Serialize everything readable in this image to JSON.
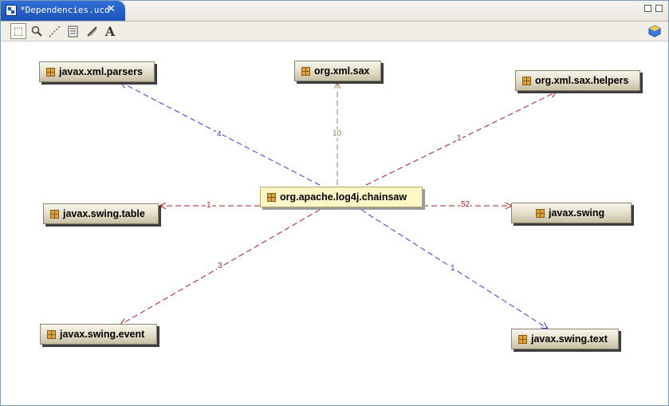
{
  "tab": {
    "title": "*Dependencies.ucd",
    "close": "✕"
  },
  "toolbar": {
    "tools": [
      {
        "name": "select-tool",
        "glyph": "⬚"
      },
      {
        "name": "zoom-tool",
        "glyph": "🔍"
      },
      {
        "name": "connector-tool",
        "glyph": "⋰"
      },
      {
        "name": "note-tool",
        "glyph": "▤"
      },
      {
        "name": "link-tool",
        "glyph": "✎"
      },
      {
        "name": "text-tool",
        "glyph": "A"
      }
    ],
    "right_icon": "package-cube-icon"
  },
  "colors": {
    "blue_edge": "#2a3fd6",
    "red_edge": "#a31f1f",
    "brown_edge": "#a47a56"
  },
  "diagram": {
    "center": {
      "label": "org.apache.log4j.chainsaw"
    },
    "packages": [
      {
        "id": "xmlparsers",
        "label": "javax.xml.parsers"
      },
      {
        "id": "xmlsax",
        "label": "org.xml.sax"
      },
      {
        "id": "saxhelpers",
        "label": "org.xml.sax.helpers"
      },
      {
        "id": "swingtable",
        "label": "javax.swing.table"
      },
      {
        "id": "swing",
        "label": "javax.swing"
      },
      {
        "id": "swingevent",
        "label": "javax.swing.event"
      },
      {
        "id": "swingtext",
        "label": "javax.swing.text"
      }
    ],
    "edges": [
      {
        "to": "xmlparsers",
        "count": "4",
        "color": "blue"
      },
      {
        "to": "xmlsax",
        "count": "10",
        "color": "brown"
      },
      {
        "to": "saxhelpers",
        "count": "1",
        "color": "red"
      },
      {
        "to": "swingtable",
        "count": "1",
        "color": "red"
      },
      {
        "to": "swing",
        "count": "52",
        "color": "red"
      },
      {
        "to": "swingevent",
        "count": "3",
        "color": "red"
      },
      {
        "to": "swingtext",
        "count": "1",
        "color": "blue"
      }
    ]
  }
}
